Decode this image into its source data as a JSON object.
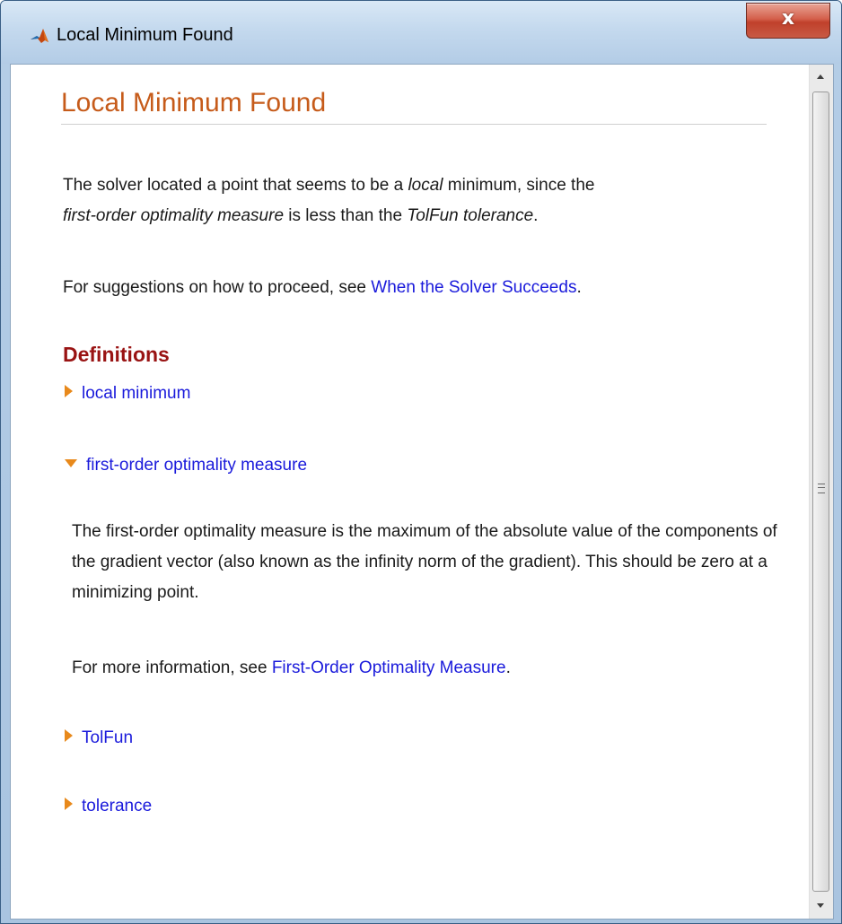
{
  "window": {
    "title": "Local Minimum Found",
    "close_label": "x"
  },
  "content": {
    "title": "Local Minimum Found",
    "intro": {
      "t1": "The solver located a point that seems to be a ",
      "t2": "local",
      "t3": " minimum, since the",
      "t4": "first-order optimality measure",
      "t5": " is less than the ",
      "t6": "TolFun tolerance",
      "t7": "."
    },
    "suggestion": {
      "text": "For suggestions on how to proceed, see ",
      "link": "When the Solver Succeeds",
      "end": "."
    },
    "definitions": {
      "heading": "Definitions",
      "items": [
        {
          "label": "local minimum",
          "expanded": false
        },
        {
          "label": "first-order optimality measure",
          "expanded": true
        },
        {
          "label": "TolFun",
          "expanded": false
        },
        {
          "label": "tolerance",
          "expanded": false
        }
      ],
      "expanded_body": "The first-order optimality measure is the maximum of the absolute value of the components of the gradient vector (also known as the infinity norm of the gradient). This should be zero at a minimizing point.",
      "more_info": {
        "text": "For more information, see ",
        "link": "First-Order Optimality Measure",
        "end": "."
      }
    }
  },
  "colors": {
    "title": "#c65b1a",
    "heading": "#991313",
    "link": "#1a1adb",
    "triangle": "#e8891b"
  },
  "icons": {
    "app_icon": "matlab-membrane-icon",
    "close": "close-icon"
  }
}
